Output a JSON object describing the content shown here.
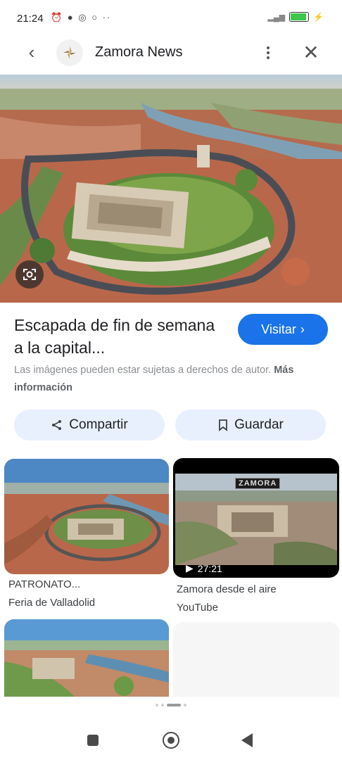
{
  "status": {
    "time": "21:24",
    "icons": "⏰ ● ◎ ○ ··"
  },
  "header": {
    "site_name": "Zamora News"
  },
  "result": {
    "title": "Escapada de fin de semana a la capital...",
    "visit_label": "Visitar",
    "rights_text": "Las imágenes pueden estar sujetas a derechos de autor.",
    "more_info": "Más información",
    "share_label": "Compartir",
    "save_label": "Guardar"
  },
  "related": [
    {
      "title": "PATRONATO...",
      "source": "Feria de Valladolid"
    },
    {
      "title": "Zamora desde el aire",
      "source": "YouTube",
      "duration": "27:21",
      "overlay_text": "ZAMORA"
    }
  ],
  "colors": {
    "accent": "#1a73e8",
    "chip_bg": "#e8f0fe"
  }
}
